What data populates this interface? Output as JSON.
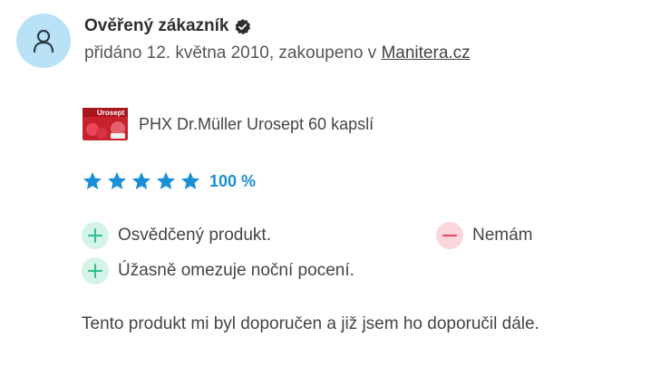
{
  "review": {
    "author": "Ověřený zákazník",
    "meta_prefix": "přidáno 12. května 2010, zakoupeno v ",
    "shop_link": "Manitera.cz",
    "product": {
      "name": "PHX Dr.Müller Urosept 60 kapslí",
      "thumb_text": "Urosept"
    },
    "rating": {
      "stars": 5,
      "max": 5,
      "percent_label": "100 %"
    },
    "pros": [
      "Osvědčený produkt.",
      "Úžasně omezuje noční pocení."
    ],
    "cons": [
      "Nemám"
    ],
    "text": "Tento produkt mi byl doporučen a již jsem ho doporučil dále."
  },
  "colors": {
    "star": "#1a8fd6",
    "avatar_bg": "#b9e2f7",
    "plus": "#2bbf8a",
    "minus": "#e0455f"
  }
}
